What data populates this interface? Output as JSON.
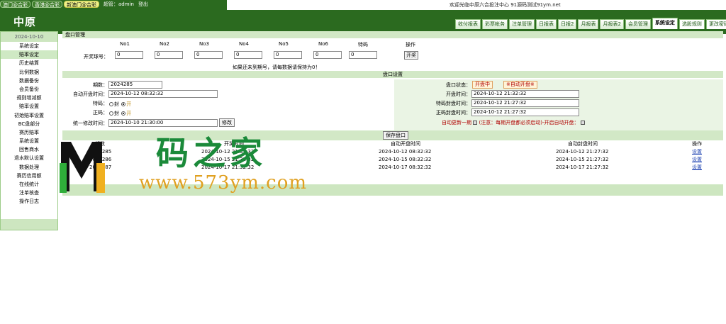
{
  "top": {
    "links": [
      "澳门@合彩",
      "香港@合彩",
      "新澳门@合彩"
    ],
    "user_label": "超管：admin",
    "logout": "登出",
    "notice": "欢迎光临中原六合投注中心 91源码测试91ym.net",
    "logo": "中原"
  },
  "tabs": [
    "收付报表",
    "彩票帐务",
    "注单管理",
    "日报表",
    "日报2",
    "月报表",
    "月报表2",
    "会员管理",
    "系统设定",
    "选股规则",
    "更改密码"
  ],
  "active_tab": "系统设定",
  "sidebar": {
    "date": "2024-10-10",
    "items": [
      "系统设定",
      "赔率设定",
      "历史结算",
      "比例数据",
      "数据备份",
      "会员备份",
      "规则增减额",
      "赔率设置",
      "初始赔率设置",
      "BC盘部分",
      "赛历赔率",
      "系统设置",
      "回售商水",
      "退水默认设置",
      "数据处理",
      "赛历信用额",
      "在线统计",
      "注单核查",
      "操作日志"
    ],
    "active": "赔率设定"
  },
  "main": {
    "title": "盘口管理",
    "result": {
      "draw_label": "开奖球号：",
      "cols": [
        "No1",
        "No2",
        "No3",
        "No4",
        "No5",
        "No6",
        "特码"
      ],
      "values": [
        "0",
        "0",
        "0",
        "0",
        "0",
        "0",
        "0"
      ],
      "op_label": "操作",
      "op_button": "开奖",
      "tip": "如果还未到期号，请每数据请保持为0！"
    },
    "settings_title": "盘口设置",
    "left": {
      "period_label": "期数：",
      "period": "2024285",
      "auto_open_label": "自动开盘时间：",
      "auto_open": "2024-10-12 08:32:32",
      "special_label": "特码：",
      "normal_label": "正码：",
      "radio_off": "封",
      "radio_on": "开",
      "unified_label": "统一修改时间：",
      "unified": "2024-10-10 21:30:00",
      "unified_button": "修改"
    },
    "right": {
      "status_label": "盘口状态：",
      "status_open": "开盘中",
      "status_auto": "※自动开盘※",
      "open_label": "开盘时间：",
      "open_time": "2024-10-12 21:32:32",
      "special_close_label": "特码封盘时间：",
      "special_close": "2024-10-12 21:27:32",
      "normal_close_label": "正码封盘时间：",
      "normal_close": "2024-10-12 21:27:32",
      "auto_label": "自动更新一期",
      "auto_note": "(注意：每期开盘都必须启动)-开启自动开盘：",
      "auto_enabled": true
    },
    "save_button": "保存盘口",
    "table": {
      "headers": [
        "期数",
        "开奖时间",
        "自动开盘时间",
        "自动封盘时间",
        "操作"
      ],
      "rows": [
        {
          "period": "2024285",
          "draw": "2024-10-12 21:32:32",
          "auto_open": "2024-10-12 08:32:32",
          "auto_close": "2024-10-12 21:27:32",
          "op": "设置"
        },
        {
          "period": "2024286",
          "draw": "2024-10-15 21:32:32",
          "auto_open": "2024-10-15 08:32:32",
          "auto_close": "2024-10-15 21:27:32",
          "op": "设置"
        },
        {
          "period": "2024287",
          "draw": "2024-10-17 21:32:32",
          "auto_open": "2024-10-17 08:32:32",
          "auto_close": "2024-10-17 21:27:32",
          "op": "设置"
        }
      ]
    }
  },
  "watermark": {
    "title": "码之家",
    "url": "www.573ym.com"
  },
  "colors": {
    "header_green": "#2b6a1f",
    "panel_green": "#d2e8c6",
    "link_blue": "#1a3fb0",
    "alert_red": "#b00000"
  }
}
